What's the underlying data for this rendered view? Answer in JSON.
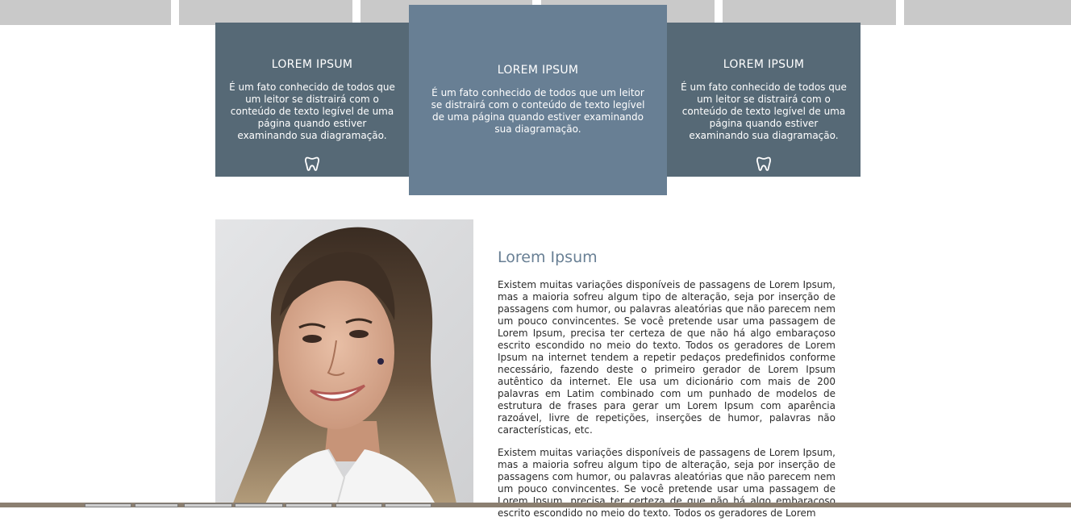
{
  "features": [
    {
      "title": "LOREM IPSUM",
      "text": "É um fato conhecido de todos que um leitor se distrairá com o conteúdo de texto legível de uma página quando estiver examinando sua diagramação.",
      "icon": "tooth-icon"
    },
    {
      "title": "LOREM IPSUM",
      "text": "É um fato conhecido de todos que um leitor se distrairá com o conteúdo de texto legível de uma página quando estiver examinando sua diagramação."
    },
    {
      "title": "LOREM IPSUM",
      "text": "É um fato conhecido de todos que um leitor se distrairá com o conteúdo de texto legível de uma página quando estiver examinando sua diagramação.",
      "icon": "tooth-icon"
    }
  ],
  "about": {
    "title": "Lorem Ipsum",
    "paragraphs": [
      "Existem muitas variações disponíveis de passagens de Lorem Ipsum, mas a maioria sofreu algum tipo de alteração, seja por inserção de passagens com humor, ou palavras aleatórias que não parecem nem um pouco convincentes. Se você pretende usar uma passagem de Lorem Ipsum, precisa ter certeza de que não há algo embaraçoso escrito escondido no meio do texto. Todos os geradores de Lorem Ipsum na internet tendem a repetir pedaços predefinidos conforme necessário, fazendo deste o primeiro gerador de Lorem Ipsum autêntico da internet. Ele usa um dicionário com mais de 200 palavras em Latim combinado com um punhado de modelos de estrutura de frases para gerar um Lorem Ipsum com aparência razoável, livre de repetições, inserções de humor, palavras não características, etc.",
      "Existem muitas variações disponíveis de passagens de Lorem Ipsum, mas a maioria sofreu algum tipo de alteração, seja por inserção de passagens com humor, ou palavras aleatórias que não parecem nem um pouco convincentes. Se você pretende usar uma passagem de Lorem Ipsum, precisa ter certeza de que não há algo embaraçoso escrito escondido no meio do texto. Todos os geradores de Lorem"
    ]
  },
  "colors": {
    "card_dark": "#566976",
    "card_center": "#687f94",
    "heading_accent": "#687f94",
    "strip_gray": "#c9c9c9"
  }
}
